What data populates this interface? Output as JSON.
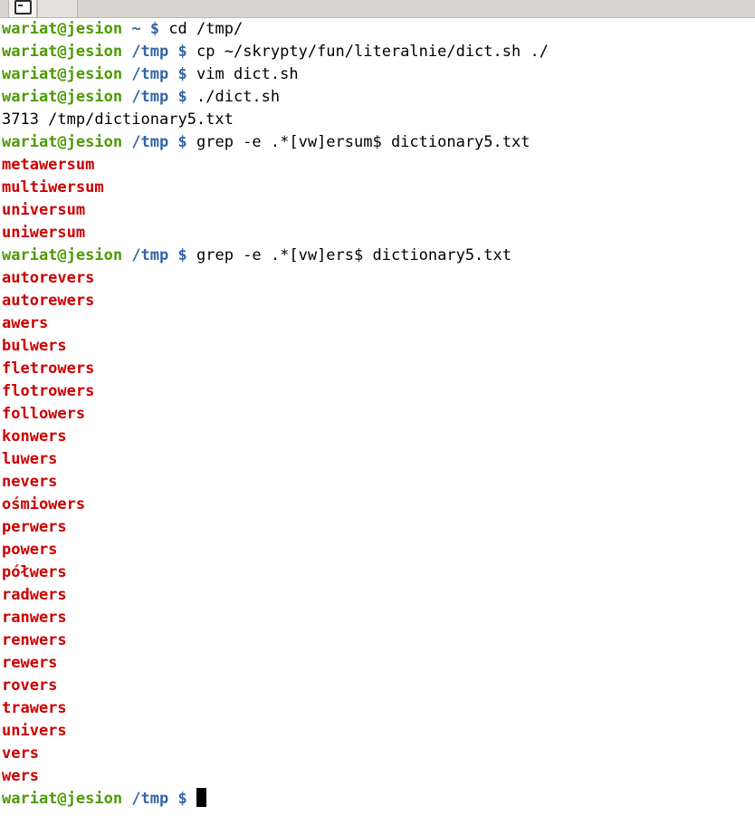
{
  "window": {
    "tabs": [
      {
        "name": "terminal-tab-active",
        "icon": "terminal-icon",
        "label": "",
        "active": true
      },
      {
        "name": "terminal-tab-second",
        "icon": "",
        "label": "",
        "active": false
      }
    ]
  },
  "terminal": {
    "prompt": {
      "user_host": "wariat@jesion",
      "dollar": "$"
    },
    "colors": {
      "user": "#4e9a06",
      "path": "#3465a4",
      "match": "#cc0000",
      "text": "#000000",
      "background": "#ffffff",
      "chrome": "#d8d5d0"
    },
    "lines": [
      {
        "type": "prompt",
        "user": "wariat@jesion",
        "path": "~",
        "dollar": "$",
        "command": "cd /tmp/"
      },
      {
        "type": "prompt",
        "user": "wariat@jesion",
        "path": "/tmp",
        "dollar": "$",
        "command": "cp ~/skrypty/fun/literalnie/dict.sh ./"
      },
      {
        "type": "prompt",
        "user": "wariat@jesion",
        "path": "/tmp",
        "dollar": "$",
        "command": "vim dict.sh"
      },
      {
        "type": "prompt",
        "user": "wariat@jesion",
        "path": "/tmp",
        "dollar": "$",
        "command": "./dict.sh"
      },
      {
        "type": "output",
        "text": "3713 /tmp/dictionary5.txt"
      },
      {
        "type": "prompt",
        "user": "wariat@jesion",
        "path": "/tmp",
        "dollar": "$",
        "command": "grep -e .*[vw]ersum$ dictionary5.txt"
      },
      {
        "type": "match",
        "text": "metawersum"
      },
      {
        "type": "match",
        "text": "multiwersum"
      },
      {
        "type": "match",
        "text": "universum"
      },
      {
        "type": "match",
        "text": "uniwersum"
      },
      {
        "type": "prompt",
        "user": "wariat@jesion",
        "path": "/tmp",
        "dollar": "$",
        "command": "grep -e .*[vw]ers$ dictionary5.txt"
      },
      {
        "type": "match",
        "text": "autorevers"
      },
      {
        "type": "match",
        "text": "autorewers"
      },
      {
        "type": "match",
        "text": "awers"
      },
      {
        "type": "match",
        "text": "bulwers"
      },
      {
        "type": "match",
        "text": "fletrowers"
      },
      {
        "type": "match",
        "text": "flotrowers"
      },
      {
        "type": "match",
        "text": "followers"
      },
      {
        "type": "match",
        "text": "konwers"
      },
      {
        "type": "match",
        "text": "luwers"
      },
      {
        "type": "match",
        "text": "nevers"
      },
      {
        "type": "match",
        "text": "ośmiowers"
      },
      {
        "type": "match",
        "text": "perwers"
      },
      {
        "type": "match",
        "text": "powers"
      },
      {
        "type": "match",
        "text": "półwers"
      },
      {
        "type": "match",
        "text": "radwers"
      },
      {
        "type": "match",
        "text": "ranwers"
      },
      {
        "type": "match",
        "text": "renwers"
      },
      {
        "type": "match",
        "text": "rewers"
      },
      {
        "type": "match",
        "text": "rovers"
      },
      {
        "type": "match",
        "text": "trawers"
      },
      {
        "type": "match",
        "text": "univers"
      },
      {
        "type": "match",
        "text": "vers"
      },
      {
        "type": "match",
        "text": "wers"
      },
      {
        "type": "cursor",
        "user": "wariat@jesion",
        "path": "/tmp",
        "dollar": "$",
        "command": ""
      }
    ]
  }
}
